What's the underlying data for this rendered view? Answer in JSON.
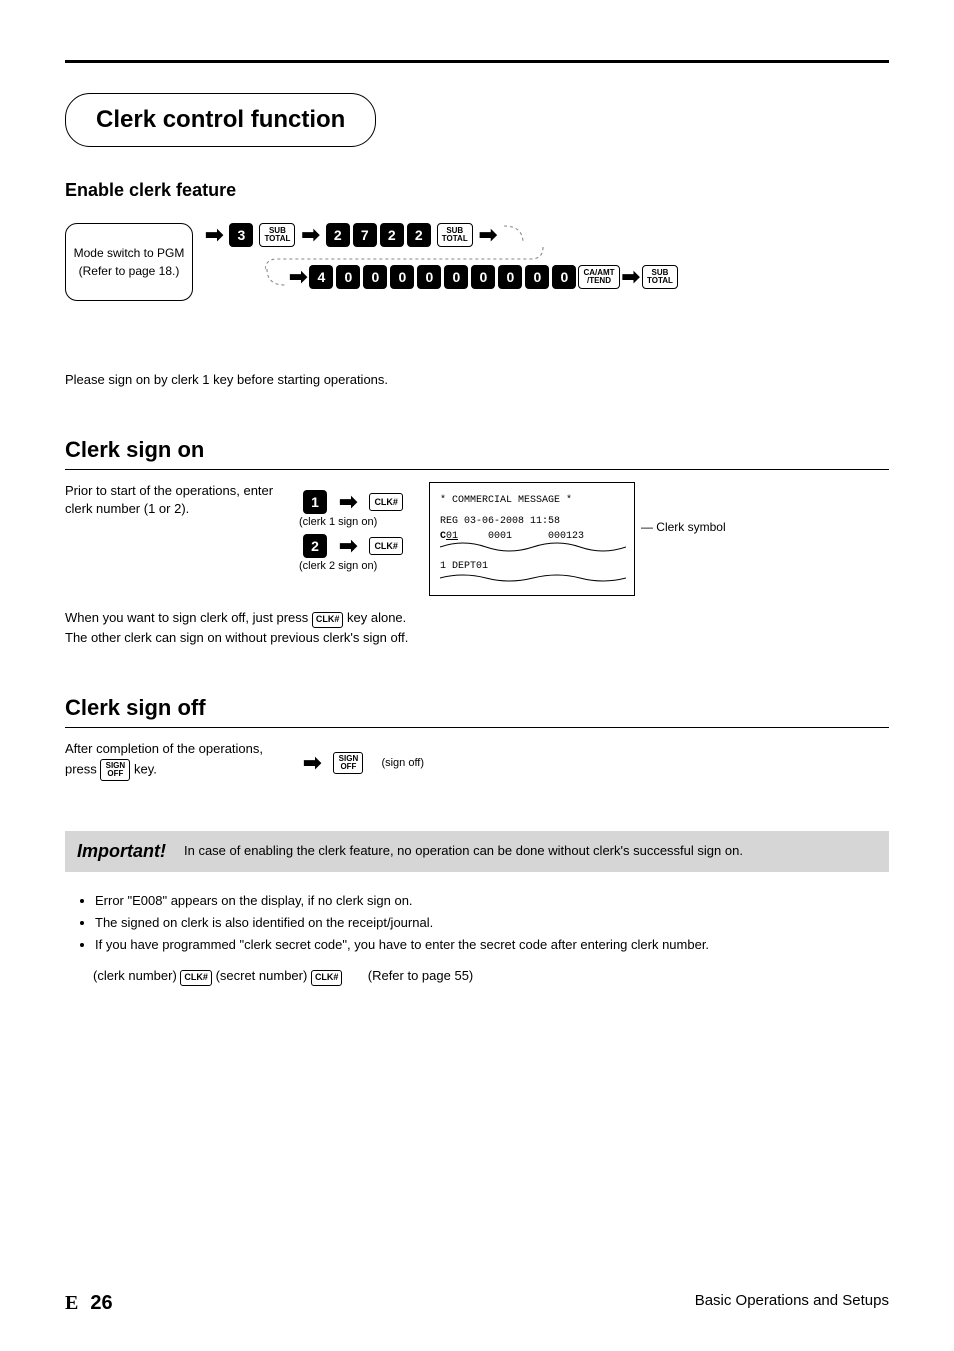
{
  "title": "Clerk control function",
  "subtitle": "Enable clerk feature",
  "example_step1": "Mode switch to PGM",
  "example_step2": "(Refer to page 18.)",
  "key_sub": "SUB",
  "key_total": "TOTAL",
  "key_caamt": "CA/AMT",
  "key_tend": "/TEND",
  "key_clk": "CLK#",
  "key_sign": "SIGN",
  "key_off": "OFF",
  "seq1_prefix": "3",
  "seq1_code": [
    "2",
    "7",
    "2",
    "2"
  ],
  "seq2_digits": [
    "4",
    "0",
    "0",
    "0",
    "0",
    "0",
    "0",
    "0",
    "0",
    "0"
  ],
  "footnote": "Please sign on by clerk 1 key before starting operations.",
  "signon_heading": "Clerk sign on",
  "signon_desc": "Prior to start of the operations, enter clerk number (1 or 2).",
  "signon_step1_label": "(clerk 1 sign on)",
  "signon_step2_label": "(clerk 2 sign on)",
  "signon_key1": "1",
  "signon_key2": "2",
  "receipt_line1": "*  COMMERCIAL MESSAGE  *",
  "receipt_line2": "REG  03-06-2008 11:58",
  "receipt_prefix": "C",
  "receipt_cnum": "01",
  "receipt_mid": "0001",
  "receipt_right": "000123",
  "receipt_line4": " 1 DEPT01",
  "receipt_note_label": "— Clerk symbol",
  "note_under": "When you want to sign clerk off, just press ",
  "note_under_after": " key alone.",
  "note_under2": "The other clerk can sign on without previous clerk's sign off.",
  "signoff_heading": "Clerk sign off",
  "signoff_desc": "After completion of the operations, press ",
  "signoff_desc_after": " key.",
  "signoff_label": "(sign off)",
  "important_label": "Important!",
  "important_text": "In case of enabling the clerk feature, no operation can be done without clerk's successful sign on.",
  "bullets": [
    "Error \"E008\" appears on the display, if no clerk sign on.",
    "The signed on clerk is also identified on the receipt/journal.",
    "If you have programmed \"clerk secret code\", you have to enter the secret code after entering clerk number."
  ],
  "refnote_prefix": "(clerk number)  ",
  "refnote_mid": " (secret number)  ",
  "refnote_suffix": "(Refer to page 55)",
  "footer_page": "26",
  "footer_right": "Basic Operations and Setups"
}
